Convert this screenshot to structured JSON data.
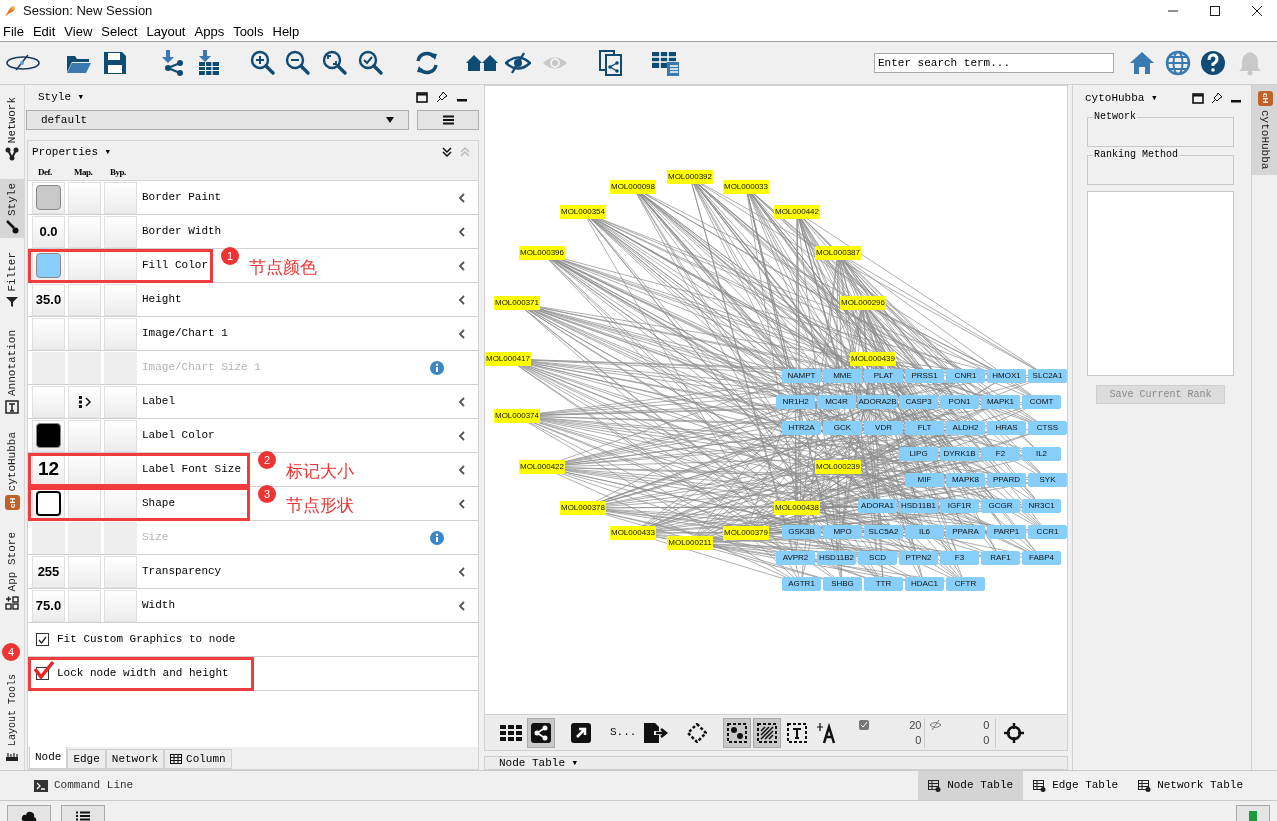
{
  "window": {
    "title": "Session: New Session"
  },
  "menu": [
    "File",
    "Edit",
    "View",
    "Select",
    "Layout",
    "Apps",
    "Tools",
    "Help"
  ],
  "search": {
    "placeholder": "Enter search term..."
  },
  "left_tabs": [
    {
      "label": "Network",
      "selected": false,
      "kind": "network"
    },
    {
      "label": "Style",
      "selected": true,
      "kind": "style"
    },
    {
      "label": "Filter",
      "selected": false,
      "kind": "filter"
    },
    {
      "label": "Annotation",
      "selected": false,
      "kind": "annotation"
    },
    {
      "label": "cytoHubba",
      "selected": false,
      "kind": "badge",
      "badge": "cH"
    },
    {
      "label": "App Store",
      "selected": false,
      "kind": "apps"
    },
    {
      "label": "Layout Tools",
      "selected": false,
      "kind": "ruler"
    }
  ],
  "style_panel": {
    "title": "Style ▾",
    "style_name": "default",
    "section": "Properties ▾",
    "columns": [
      "Def.",
      "Map.",
      "Byp."
    ],
    "properties": [
      {
        "name": "Border Paint",
        "kind": "color",
        "color": "#c8c8c8",
        "mapped": false,
        "disabled": false
      },
      {
        "name": "Border Width",
        "kind": "number",
        "value": "0.0",
        "mapped": false,
        "disabled": false
      },
      {
        "name": "Fill Color",
        "kind": "color",
        "color": "#87cefa",
        "mapped": false,
        "disabled": false,
        "callout": {
          "number": "1",
          "text": "节点颜色"
        }
      },
      {
        "name": "Height",
        "kind": "number",
        "value": "35.0",
        "mapped": false,
        "disabled": false
      },
      {
        "name": "Image/Chart 1",
        "kind": "none",
        "mapped": false,
        "disabled": false
      },
      {
        "name": "Image/Chart Size 1",
        "kind": "none",
        "mapped": false,
        "disabled": true
      },
      {
        "name": "Label",
        "kind": "none",
        "mapped": true,
        "disabled": false
      },
      {
        "name": "Label Color",
        "kind": "color",
        "color": "#000000",
        "mapped": false,
        "disabled": false
      },
      {
        "name": "Label Font Size",
        "kind": "number",
        "value": "12",
        "mapped": false,
        "disabled": false,
        "callout": {
          "number": "2",
          "text": "标记大小"
        }
      },
      {
        "name": "Shape",
        "kind": "shape",
        "mapped": false,
        "disabled": false,
        "callout": {
          "number": "3",
          "text": "节点形状"
        }
      },
      {
        "name": "Size",
        "kind": "none",
        "mapped": false,
        "disabled": true
      },
      {
        "name": "Transparency",
        "kind": "number",
        "value": "255",
        "mapped": false,
        "disabled": false
      },
      {
        "name": "Width",
        "kind": "number",
        "value": "75.0",
        "mapped": false,
        "disabled": false
      }
    ],
    "options": [
      {
        "label": "Fit Custom Graphics to node",
        "checked": true
      },
      {
        "label": "Lock node width and height",
        "checked": true,
        "callout": {
          "number": "4"
        }
      }
    ],
    "tabs": [
      {
        "label": "Node",
        "selected": true
      },
      {
        "label": "Edge",
        "selected": false
      },
      {
        "label": "Network",
        "selected": false
      },
      {
        "label": "Column",
        "selected": false,
        "icon": true
      }
    ]
  },
  "network": {
    "nodes": [
      {
        "label": "MOL000098",
        "kind": "compound"
      },
      {
        "label": "MOL000392",
        "kind": "compound"
      },
      {
        "label": "MOL000033",
        "kind": "compound"
      },
      {
        "label": "MOL000354",
        "kind": "compound"
      },
      {
        "label": "MOL000442",
        "kind": "compound"
      },
      {
        "label": "MOL000396",
        "kind": "compound"
      },
      {
        "label": "MOL000387",
        "kind": "compound"
      },
      {
        "label": "MOL000371",
        "kind": "compound"
      },
      {
        "label": "MOL000296",
        "kind": "compound"
      },
      {
        "label": "MOL000417",
        "kind": "compound"
      },
      {
        "label": "MOL000439",
        "kind": "compound"
      },
      {
        "label": "MOL000374",
        "kind": "compound"
      },
      {
        "label": "MOL000239",
        "kind": "compound"
      },
      {
        "label": "MOL000422",
        "kind": "compound"
      },
      {
        "label": "MOL000378",
        "kind": "compound"
      },
      {
        "label": "MOL000438",
        "kind": "compound"
      },
      {
        "label": "MOL000433",
        "kind": "compound"
      },
      {
        "label": "MOL000211",
        "kind": "compound"
      },
      {
        "label": "MOL000379",
        "kind": "compound"
      },
      {
        "label": "NAMPT",
        "kind": "target"
      },
      {
        "label": "MME",
        "kind": "target"
      },
      {
        "label": "PLAT",
        "kind": "target"
      },
      {
        "label": "PRSS1",
        "kind": "target"
      },
      {
        "label": "CNR1",
        "kind": "target"
      },
      {
        "label": "HMOX1",
        "kind": "target"
      },
      {
        "label": "SLC2A1",
        "kind": "target"
      },
      {
        "label": "NR1H2",
        "kind": "target"
      },
      {
        "label": "MC4R",
        "kind": "target"
      },
      {
        "label": "ADORA2B",
        "kind": "target"
      },
      {
        "label": "CASP3",
        "kind": "target"
      },
      {
        "label": "PON1",
        "kind": "target"
      },
      {
        "label": "MAPK1",
        "kind": "target"
      },
      {
        "label": "COMT",
        "kind": "target"
      },
      {
        "label": "HTR2A",
        "kind": "target"
      },
      {
        "label": "GCK",
        "kind": "target"
      },
      {
        "label": "VDR",
        "kind": "target"
      },
      {
        "label": "FLT",
        "kind": "target"
      },
      {
        "label": "ALDH2",
        "kind": "target"
      },
      {
        "label": "HRAS",
        "kind": "target"
      },
      {
        "label": "CTSS",
        "kind": "target"
      },
      {
        "label": "LIPG",
        "kind": "target"
      },
      {
        "label": "DYRK1B",
        "kind": "target"
      },
      {
        "label": "F2",
        "kind": "target"
      },
      {
        "label": "IL2",
        "kind": "target"
      },
      {
        "label": "MIF",
        "kind": "target"
      },
      {
        "label": "MAPK8",
        "kind": "target"
      },
      {
        "label": "PPARD",
        "kind": "target"
      },
      {
        "label": "SYK",
        "kind": "target"
      },
      {
        "label": "ADORA1",
        "kind": "target"
      },
      {
        "label": "HSD11B1",
        "kind": "target"
      },
      {
        "label": "IGF1R",
        "kind": "target"
      },
      {
        "label": "GCGR",
        "kind": "target"
      },
      {
        "label": "NR3C1",
        "kind": "target"
      },
      {
        "label": "GSK3B",
        "kind": "target"
      },
      {
        "label": "MPO",
        "kind": "target"
      },
      {
        "label": "SLC5A2",
        "kind": "target"
      },
      {
        "label": "IL6",
        "kind": "target"
      },
      {
        "label": "PPARA",
        "kind": "target"
      },
      {
        "label": "PARP1",
        "kind": "target"
      },
      {
        "label": "CCR1",
        "kind": "target"
      },
      {
        "label": "AVPR2",
        "kind": "target"
      },
      {
        "label": "HSD11B2",
        "kind": "target"
      },
      {
        "label": "SCD",
        "kind": "target"
      },
      {
        "label": "PTPN2",
        "kind": "target"
      },
      {
        "label": "F3",
        "kind": "target"
      },
      {
        "label": "RAF1",
        "kind": "target"
      },
      {
        "label": "FABP4",
        "kind": "target"
      },
      {
        "label": "AGTR1",
        "kind": "target"
      },
      {
        "label": "SHBG",
        "kind": "target"
      },
      {
        "label": "TTR",
        "kind": "target"
      },
      {
        "label": "HDAC1",
        "kind": "target"
      },
      {
        "label": "CFTR",
        "kind": "target"
      }
    ]
  },
  "canvas_tools": [
    {
      "kind": "grid",
      "selected": false
    },
    {
      "kind": "network",
      "selected": true
    },
    {
      "kind": "arrow",
      "selected": false
    },
    {
      "kind": "text",
      "label": "S...",
      "selected": false
    },
    {
      "kind": "export",
      "selected": false
    },
    {
      "kind": "diamond",
      "selected": false
    },
    {
      "kind": "select-nodes",
      "selected": true
    },
    {
      "kind": "select-edges",
      "selected": true
    },
    {
      "kind": "textbox",
      "selected": false
    },
    {
      "kind": "font",
      "selected": false
    }
  ],
  "selection_counts": [
    "20",
    "0"
  ],
  "hidden_counts": [
    "0",
    "0"
  ],
  "table_panel": {
    "title": "Node Table ▾"
  },
  "cytohubba": {
    "title": "cytoHubba ▾",
    "groups": [
      "Network",
      "Ranking Method"
    ],
    "button": {
      "label": "Save Current Rank",
      "disabled": true
    }
  },
  "right_tabs": [
    {
      "label": "cytoHubba",
      "badge": "cH",
      "selected": true
    }
  ],
  "command_line": "Command Line",
  "table_tabs": [
    {
      "label": "Node Table",
      "selected": true
    },
    {
      "label": "Edge Table",
      "selected": false
    },
    {
      "label": "Network Table",
      "selected": false
    }
  ]
}
